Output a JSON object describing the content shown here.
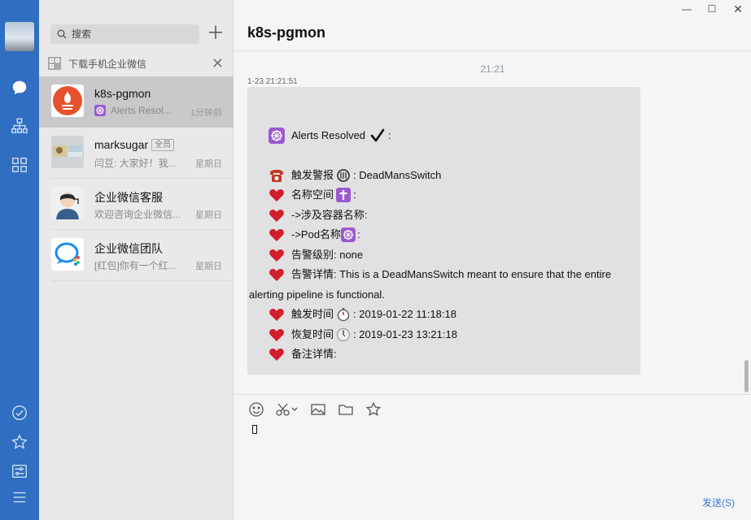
{
  "rail": {
    "nav_icons": [
      "chat-bubble-icon",
      "org-tree-icon",
      "apps-grid-icon"
    ],
    "bottom_icons": [
      "check-circle-icon",
      "star-icon",
      "settings-sliders-icon",
      "menu-icon"
    ],
    "accent": "#2f6ec0"
  },
  "list": {
    "search_placeholder": "搜索",
    "banner_text": "下载手机企业微信",
    "conversations": [
      {
        "name": "k8s-pgmon",
        "preview": "Alerts Resol...",
        "time": "1分钟前",
        "active": true
      },
      {
        "name": "marksugar",
        "badge": "全员",
        "preview": "闫豆: 大家好！我...",
        "time": "星期日"
      },
      {
        "name": "企业微信客服",
        "preview": "欢迎咨询企业微信...",
        "time": "星期日"
      },
      {
        "name": "企业微信团队",
        "preview": "[红包]你有一个红...",
        "time": "星期日"
      }
    ]
  },
  "chat": {
    "title": "k8s-pgmon",
    "time_divider": "21:21",
    "message_meta": "1-23 21:21:51",
    "message": {
      "line_header": "Alerts Resolved",
      "line_alert_label": "触发警报",
      "line_alert_value": ": DeadMansSwitch",
      "line_namespace": "名称空间",
      "line_namespace_colon": ":",
      "line_container": "->涉及容器名称:",
      "line_pod": "->Pod名称",
      "line_pod_colon": ":",
      "line_severity": "告警级别: none",
      "line_detail_1": "告警详情: This is a DeadMansSwitch meant to ensure that the entire",
      "line_detail_2": "alerting pipeline is functional.",
      "line_trigger_label": "触发时间",
      "line_trigger_value": ": 2019-01-22 11:18:18",
      "line_recover_label": "恢复时间",
      "line_recover_value": ": 2019-01-23 13:21:18",
      "line_notes": "备注详情:"
    },
    "send_label": "发送(S)",
    "bubble_color": "#e1e1e3",
    "link_color": "#3b78d2"
  }
}
